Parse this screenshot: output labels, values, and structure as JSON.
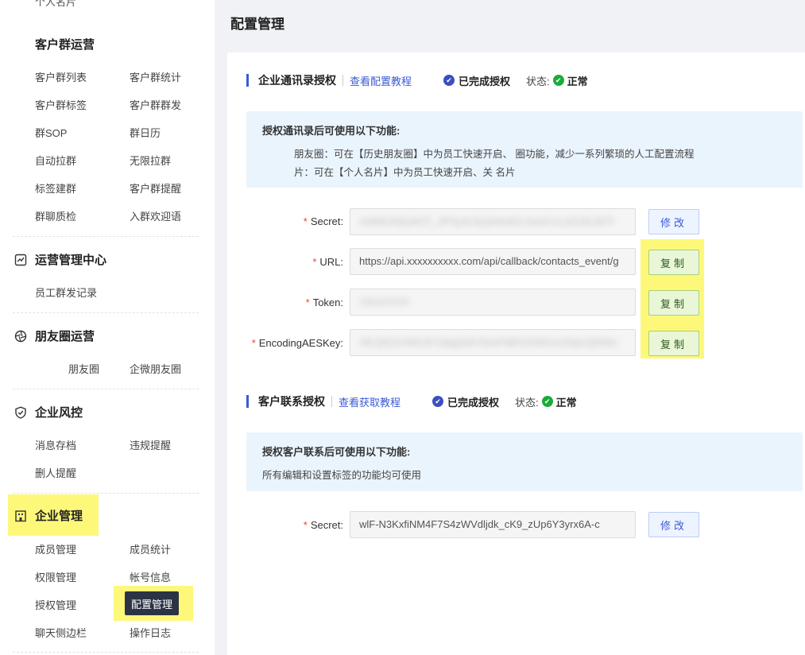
{
  "page": {
    "title": "配置管理"
  },
  "sidebar": {
    "cut_item": "个人名片",
    "groups": {
      "customer_group": {
        "title": "客户群运营",
        "items": [
          "客户群列表",
          "客户群统计",
          "客户群标签",
          "客户群群发",
          "群SOP",
          "群日历",
          "自动拉群",
          "无限拉群",
          "标签建群",
          "客户群提醒",
          "群聊质检",
          "入群欢迎语"
        ]
      },
      "ops": {
        "title": "运营管理中心",
        "items": [
          "员工群发记录"
        ]
      },
      "moments": {
        "title": "朋友圈运营",
        "items": [
          "朋友圈",
          "企微朋友圈"
        ]
      },
      "risk": {
        "title": "企业风控",
        "items": [
          "消息存档",
          "违规提醒",
          "删人提醒"
        ]
      },
      "enterprise": {
        "title": "企业管理",
        "items": [
          "成员管理",
          "成员统计",
          "权限管理",
          "帐号信息",
          "授权管理",
          "配置管理",
          "聊天侧边栏",
          "操作日志"
        ]
      }
    }
  },
  "contacts_auth": {
    "title": "企业通讯录授权",
    "link": "查看配置教程",
    "done_label": "已完成授权",
    "status_label": "状态:",
    "status_value": "正常",
    "info_title": "授权通讯录后可使用以下功能:",
    "info_line1": "朋友圈：可在【历史朋友圈】中为员工快速开启、                     圈功能，减少一系列繁琐的人工配置流程",
    "info_line2": "片：可在【个人名片】中为员工快速开启、关                        名片",
    "fields": {
      "secret": {
        "label": "Secret:",
        "value": "mAWUFjKy9CF_JPSy3c3yQnbo81L5wuCvLslZ16L5kTI",
        "button": "修改"
      },
      "url": {
        "label": "URL:",
        "value": "https://api.xxxxxxxxxx.com/api/callback/contacts_event/g",
        "button": "复制"
      },
      "token": {
        "label": "Token:",
        "value": "1ЗxxXXXX",
        "button": "复制"
      },
      "aeskey": {
        "label": "EncodingAESKey:",
        "value": "XfLQ6ZcHAKOF1dqg3alV3swFitBToSWhxxxGtpxQNNtv",
        "button": "复制"
      }
    }
  },
  "customer_auth": {
    "title": "客户联系授权",
    "link": "查看获取教程",
    "done_label": "已完成授权",
    "status_label": "状态:",
    "status_value": "正常",
    "info_title": "授权客户联系后可使用以下功能:",
    "info_line1": "所有编辑和设置标签的功能均可使用",
    "fields": {
      "secret": {
        "label": "Secret:",
        "value": "wlF-N3KxfiNM4F7S4zWVdljdk_cK9_zUp6Y3yrx6A-c",
        "button": "修改"
      }
    }
  },
  "colors": {
    "accent": "#3b5ad6",
    "highlight": "#fdf87a",
    "active_bg": "#2c3344",
    "success": "#1aac3a",
    "required": "#e5453b"
  }
}
